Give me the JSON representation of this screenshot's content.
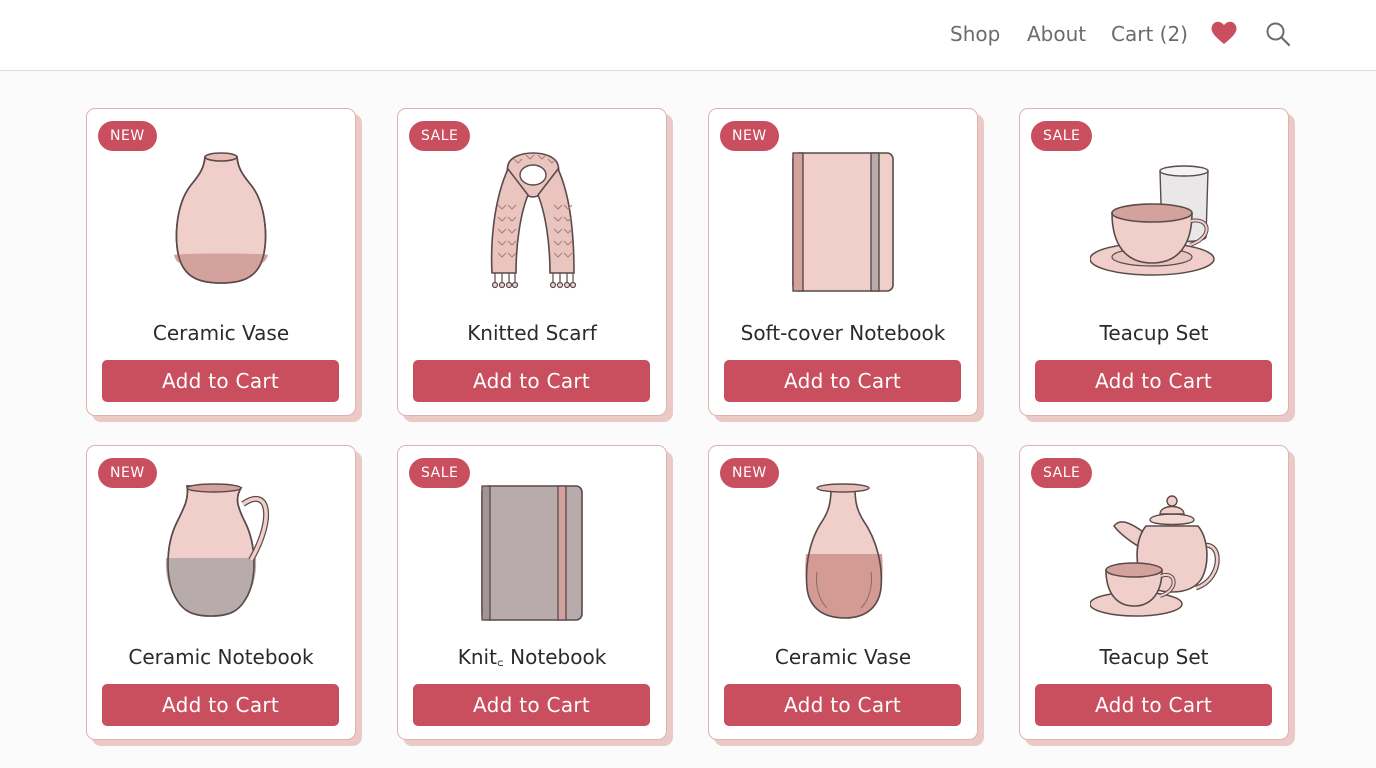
{
  "nav": {
    "shop": "Shop",
    "about": "About",
    "cart": "Cart (2)",
    "heart_icon": "heart-icon",
    "search_icon": "search-icon"
  },
  "colors": {
    "accent": "#c94f5f",
    "card_border": "#e0b3ae",
    "card_shadow": "#eac9c6",
    "pink_fill": "#f0cfca",
    "dusty_rose": "#d4a29c",
    "gray_fill": "#b8abab"
  },
  "products": [
    {
      "badge": "NEW",
      "name": "Ceramic Vase",
      "button": "Add to Cart",
      "icon": "vase-icon"
    },
    {
      "badge": "SALE",
      "name": "Knitted Scarf",
      "button": "Add to Cart",
      "icon": "scarf-icon"
    },
    {
      "badge": "NEW",
      "name": "Soft-cover Notebook",
      "button": "Add to Cart",
      "icon": "notebook-icon"
    },
    {
      "badge": "SALE",
      "name": "Teacup Set",
      "button": "Add to Cart",
      "icon": "teacup-icon"
    },
    {
      "badge": "NEW",
      "name": "Ceramic Notebook",
      "button": "Add to Cart",
      "icon": "pitcher-icon"
    },
    {
      "badge": "SALE",
      "name": "Knit꜀ Notebook",
      "button": "Add to Cart",
      "icon": "notebook-icon"
    },
    {
      "badge": "NEW",
      "name": "Ceramic Vase",
      "button": "Add to Cart",
      "icon": "vase-icon"
    },
    {
      "badge": "SALE",
      "name": "Teacup Set",
      "button": "Add to Cart",
      "icon": "teapot-icon"
    }
  ]
}
